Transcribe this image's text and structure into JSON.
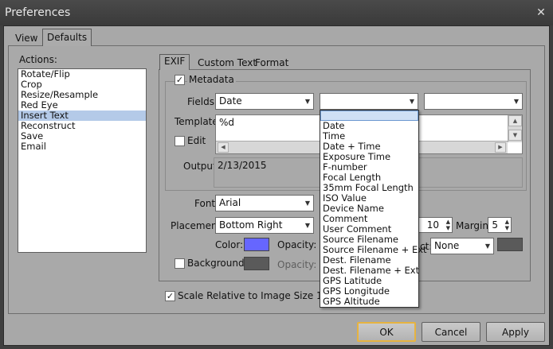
{
  "window": {
    "title": "Preferences",
    "close_glyph": "✕"
  },
  "top_tabs": [
    "View",
    "Defaults"
  ],
  "actions": {
    "label": "Actions:",
    "items": [
      "Rotate/Flip",
      "Crop",
      "Resize/Resample",
      "Red Eye",
      "Insert Text",
      "Reconstruct",
      "Save",
      "Email"
    ],
    "selected": "Insert Text"
  },
  "inner_tabs": [
    "EXIF",
    "Custom Text",
    "Format"
  ],
  "metadata": {
    "checkbox_label": "Metadata",
    "checked": true,
    "fields_label": "Fields:",
    "field1_value": "Date",
    "template_label": "Template:",
    "template_value": "%d",
    "edit_label": "Edit",
    "edit_checked": false,
    "output_label": "Output:",
    "output_value": "2/13/2015"
  },
  "dropdown_options": [
    "",
    "Date",
    "Time",
    "Date + Time",
    "Exposure Time",
    "F-number",
    "Focal Length",
    "35mm Focal Length",
    "ISO Value",
    "Device Name",
    "Comment",
    "User Comment",
    "Source Filename",
    "Source Filename + Ext",
    "Dest. Filename",
    "Dest. Filename + Ext",
    "GPS Latitude",
    "GPS Longitude",
    "GPS Altitude"
  ],
  "format": {
    "font_label": "Font:",
    "font_value": "Arial",
    "placement_label": "Placement:",
    "placement_value": "Bottom Right",
    "size_value": "10",
    "margin_label": "Margin:",
    "margin_value": "5",
    "color_label": "Color:",
    "color_hex": "#6666ff",
    "opacity_label": "Opacity:",
    "effect_label": "ct:",
    "effect_value": "None",
    "effect_color_hex": "#5a5a5a",
    "background_label": "Background:",
    "background_checked": false,
    "background_color_hex": "#5a5a5a",
    "bg_opacity_label": "Opacity:"
  },
  "scale": {
    "label": "Scale Relative to Image Size 1600x12",
    "checked": true
  },
  "buttons": {
    "ok": "OK",
    "cancel": "Cancel",
    "apply": "Apply"
  },
  "icons": {
    "check": "✓",
    "down": "▼",
    "up": "▲",
    "left": "◀",
    "right": "▶"
  }
}
